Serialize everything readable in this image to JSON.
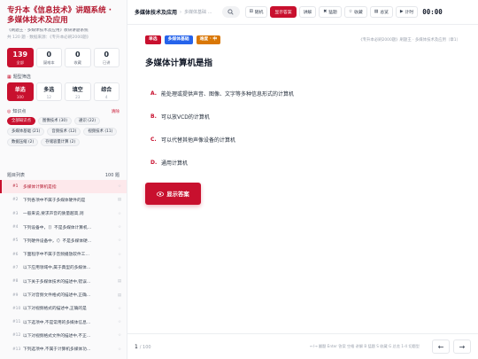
{
  "sidebar": {
    "title": "专升本《信息技术》讲题系统 · 多媒体技术及应用",
    "subtitle": "《刷题王 · 多媒体技术及应用》教研讲题系统",
    "meta": "共 120 题 · 数据来源：《专升本必刷2000题》",
    "stats": [
      {
        "num": "139",
        "label": "全部"
      },
      {
        "num": "0",
        "label": "疑难本"
      },
      {
        "num": "0",
        "label": "收藏"
      },
      {
        "num": "0",
        "label": "已讲"
      }
    ],
    "type_section_label": "题型筛选",
    "types": [
      {
        "name": "单选",
        "count": "100"
      },
      {
        "name": "多选",
        "count": "12"
      },
      {
        "name": "填空",
        "count": "23"
      },
      {
        "name": "综合",
        "count": "4"
      }
    ],
    "kp_section_label": "知识点",
    "kp_clear": "清除",
    "chips": [
      "全部知识点",
      "图像技术 (30)",
      "通识 (22)",
      "多媒体基础 (21)",
      "音频技术 (12)",
      "视频技术 (11)",
      "数据压缩 (2)",
      "存储容量计算 (2)"
    ],
    "list_label": "题目列表",
    "list_count": "100 题",
    "questions": [
      {
        "n": "#1",
        "t": "多媒体计算机是指",
        "icon": "☆"
      },
      {
        "n": "#2",
        "t": "下列各项中不属于多媒体硬件的是",
        "icon": "▤"
      },
      {
        "n": "#3",
        "t": "一般来说,要求声音的质量越高,则",
        "icon": "☆"
      },
      {
        "n": "#4",
        "t": "下列设备中，（）不是多媒体计算机…",
        "icon": "☆"
      },
      {
        "n": "#5",
        "t": "下列硬件设备中，（）不是多媒体硬…",
        "icon": "☆"
      },
      {
        "n": "#6",
        "t": "下面程序中不属于音频播放软件工…",
        "icon": "☆"
      },
      {
        "n": "#7",
        "t": "以下应用领域中,属于典型的多媒体…",
        "icon": "☆"
      },
      {
        "n": "#8",
        "t": "以下关于多媒体技术的描述中,错误…",
        "icon": "▤"
      },
      {
        "n": "#9",
        "t": "以下对音频文件格式的描述中,正确…",
        "icon": "▤"
      },
      {
        "n": "#10",
        "t": "以下对视频格式的描述中,正确的是",
        "icon": "☆"
      },
      {
        "n": "#11",
        "t": "以下选项中,不是常用的多媒体信息…",
        "icon": "☆"
      },
      {
        "n": "#12",
        "t": "以下对视频格式文件的描述中,不正…",
        "icon": "☆"
      },
      {
        "n": "#13",
        "t": "下列选项中,不属于计算机多媒体功…",
        "icon": "☆"
      }
    ]
  },
  "topbar": {
    "crumb_main": "多媒体技术及应用",
    "crumb_sep": "›",
    "crumb_sub": "多媒体基础 …",
    "buttons": [
      {
        "icon": "⚄",
        "label": "随机"
      },
      {
        "icon": "",
        "label": "显示答案"
      },
      {
        "icon": "",
        "label": "讲解"
      },
      {
        "icon": "✖",
        "label": "猛题"
      },
      {
        "icon": "☆",
        "label": "收藏"
      },
      {
        "icon": "▤",
        "label": "总览"
      },
      {
        "icon": "▶",
        "label": "计时"
      }
    ],
    "timer": "00:00"
  },
  "question": {
    "tags": [
      "单选",
      "多媒体基础",
      "难度 · 中"
    ],
    "source": "《专升本必刷2000题》刷题王 · 多媒体技术及应用（章1）",
    "title": "多媒体计算机是指",
    "options": [
      {
        "letter": "A.",
        "text": "能处理或提供声音、图像、文字等多种信息形式的计算机"
      },
      {
        "letter": "B.",
        "text": "可以放VCD的计算机"
      },
      {
        "letter": "C.",
        "text": "可以代替其他声像设备的计算机"
      },
      {
        "letter": "D.",
        "text": "通用计算机"
      }
    ],
    "show_answer": "显示答案"
  },
  "bottombar": {
    "page": "1",
    "total": "/ 100",
    "hint": "←/→ 翻题  Enter 答案  空格 讲解  B 猛题  S 收藏  G 总览  1-4 切题型",
    "prev": "←",
    "next": "→"
  },
  "colors": {
    "accent": "#c8102e",
    "blue": "#2563eb",
    "orange": "#d97706"
  }
}
